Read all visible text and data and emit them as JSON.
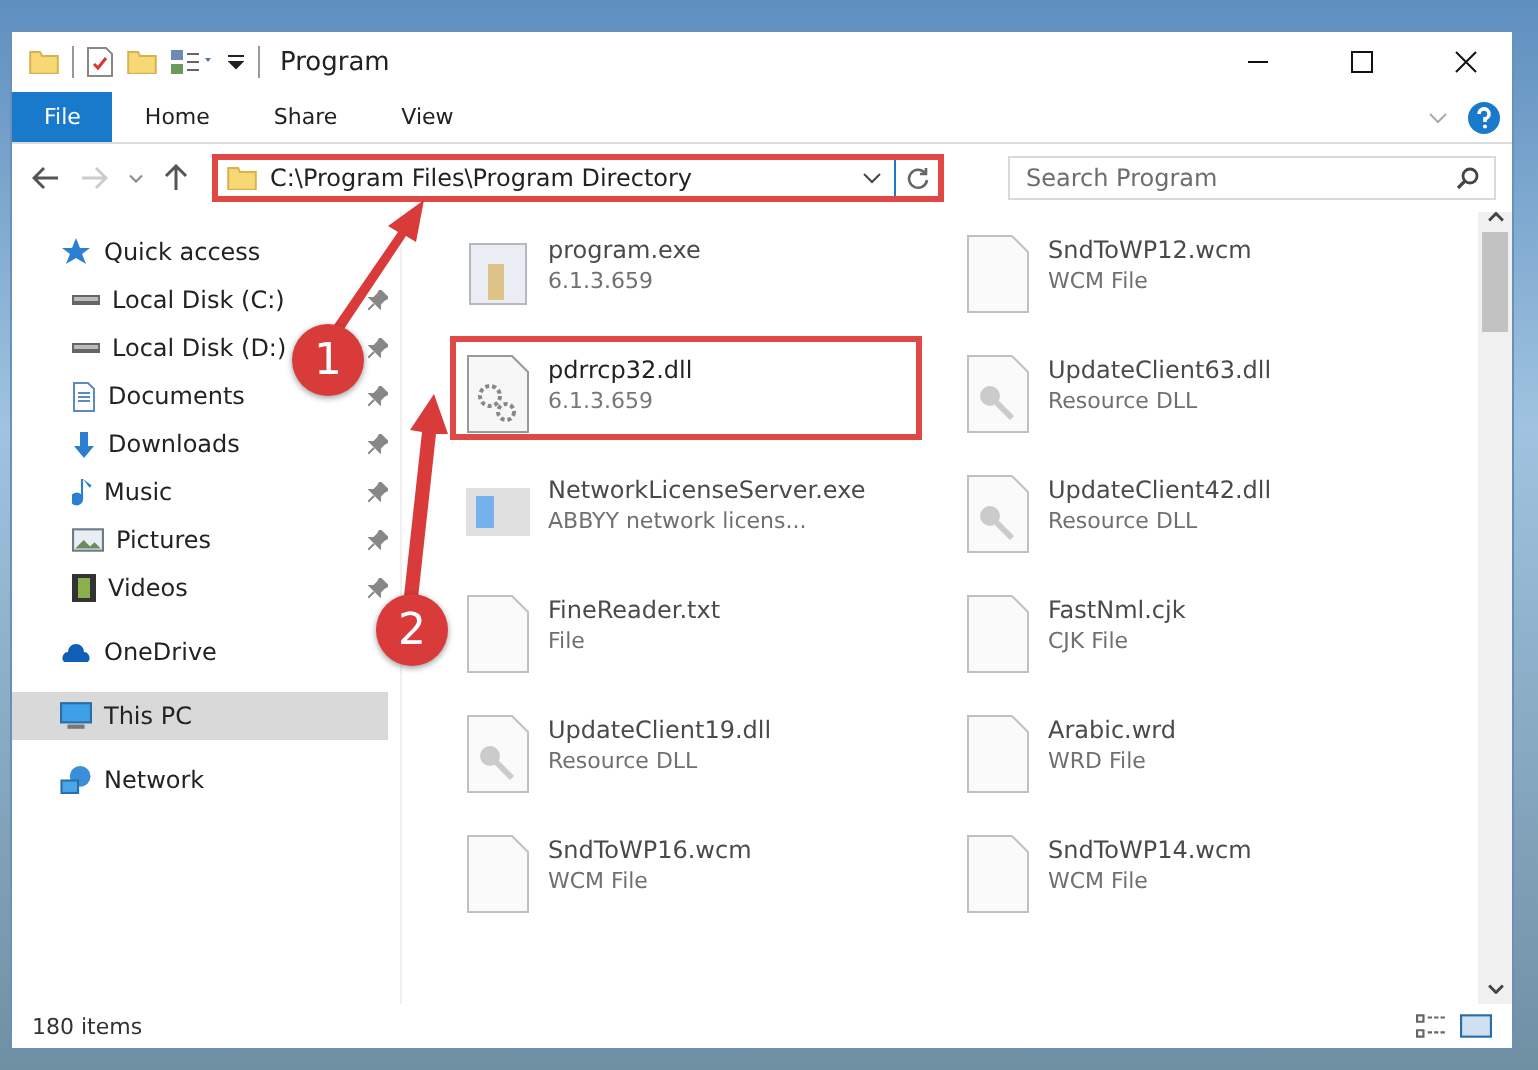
{
  "window": {
    "title": "Program"
  },
  "ribbon_tabs": [
    {
      "label": "File",
      "kind": "file"
    },
    {
      "label": "Home",
      "kind": "tab"
    },
    {
      "label": "Share",
      "kind": "tab"
    },
    {
      "label": "View",
      "kind": "tab"
    }
  ],
  "address_bar": {
    "path": "C:\\Program Files\\Program Directory",
    "highlighted": true
  },
  "search": {
    "placeholder": "Search Program"
  },
  "sidebar": {
    "items": [
      {
        "label": "Quick access",
        "selected": false,
        "children": [
          {
            "label": "Local Disk (C:)",
            "pinned": true,
            "selected": false
          },
          {
            "label": "Local Disk (D:)",
            "pinned": true,
            "selected": false
          },
          {
            "label": "Documents",
            "pinned": true,
            "selected": false
          },
          {
            "label": "Downloads",
            "pinned": true,
            "selected": false
          },
          {
            "label": "Music",
            "pinned": true,
            "selected": false
          },
          {
            "label": "Pictures",
            "pinned": true,
            "selected": false
          },
          {
            "label": "Videos",
            "pinned": true,
            "selected": false
          }
        ]
      },
      {
        "label": "OneDrive",
        "selected": false
      },
      {
        "label": "This PC",
        "selected": true
      },
      {
        "label": "Network",
        "selected": false
      }
    ]
  },
  "files": [
    {
      "name": "program.exe",
      "detail": "6.1.3.659",
      "kind": "exe",
      "highlighted": false,
      "blurred": true
    },
    {
      "name": "SndToWP12.wcm",
      "detail": "WCM File",
      "kind": "blank",
      "highlighted": false,
      "blurred": true
    },
    {
      "name": "pdrrcp32.dll",
      "detail": "6.1.3.659",
      "kind": "gears",
      "highlighted": true,
      "blurred": false
    },
    {
      "name": "UpdateClient63.dll",
      "detail": "Resource DLL",
      "kind": "resource",
      "highlighted": false,
      "blurred": true
    },
    {
      "name": "NetworkLicenseServer.exe",
      "detail": "ABBYY network licens...",
      "kind": "network",
      "highlighted": false,
      "blurred": true
    },
    {
      "name": "UpdateClient42.dll",
      "detail": "Resource DLL",
      "kind": "resource",
      "highlighted": false,
      "blurred": true
    },
    {
      "name": "FineReader.txt",
      "detail": "File",
      "kind": "blank",
      "highlighted": false,
      "blurred": true
    },
    {
      "name": "FastNml.cjk",
      "detail": "CJK File",
      "kind": "blank",
      "highlighted": false,
      "blurred": true
    },
    {
      "name": "UpdateClient19.dll",
      "detail": "Resource DLL",
      "kind": "resource",
      "highlighted": false,
      "blurred": true
    },
    {
      "name": "Arabic.wrd",
      "detail": "WRD File",
      "kind": "blank",
      "highlighted": false,
      "blurred": true
    },
    {
      "name": "SndToWP16.wcm",
      "detail": "WCM File",
      "kind": "blank",
      "highlighted": false,
      "blurred": true
    },
    {
      "name": "SndToWP14.wcm",
      "detail": "WCM File",
      "kind": "blank",
      "highlighted": false,
      "blurred": true
    }
  ],
  "annotations": [
    {
      "number": "1"
    },
    {
      "number": "2"
    }
  ],
  "status_bar": {
    "count": "180 items"
  }
}
